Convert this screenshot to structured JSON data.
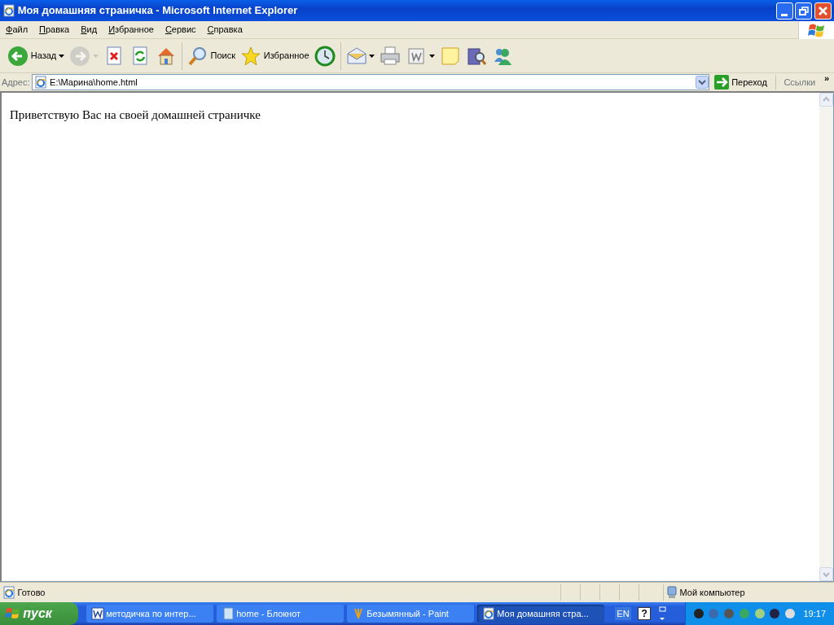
{
  "window": {
    "title": "Моя домашняя страничка - Microsoft Internet Explorer"
  },
  "menu": [
    "Файл",
    "Правка",
    "Вид",
    "Избранное",
    "Сервис",
    "Справка"
  ],
  "toolbar": [
    {
      "label": "Назад",
      "dropdown": true,
      "disabled": false
    },
    {
      "dropdown": true,
      "disabled": true
    },
    {
      "dropdown": false,
      "disabled": false
    },
    {
      "dropdown": false,
      "disabled": false
    },
    {
      "dropdown": false,
      "disabled": false
    },
    {
      "label": "Поиск",
      "dropdown": false,
      "disabled": false
    },
    {
      "label": "Избранное",
      "dropdown": false,
      "disabled": false
    },
    {
      "dropdown": false,
      "disabled": false
    },
    {
      "dropdown": true,
      "disabled": false
    },
    {
      "dropdown": false,
      "disabled": false
    },
    {
      "dropdown": true,
      "disabled": false
    },
    {
      "dropdown": false,
      "disabled": false
    },
    {
      "dropdown": false,
      "disabled": false
    },
    {
      "dropdown": false,
      "disabled": false
    }
  ],
  "address": {
    "label": "Адрес:",
    "value": "E:\\Марина\\home.html",
    "go": "Переход",
    "links": "Ссылки",
    "more": "»"
  },
  "page": {
    "text": "Приветствую Вас на своей домашней страничке"
  },
  "status_bar": {
    "text": "Готово",
    "zone": "Мой компьютер"
  },
  "taskbar": {
    "start": "пуск",
    "tasks": [
      {
        "label": "методичка по интер...",
        "selected": false
      },
      {
        "label": "home - Блокнот",
        "selected": false
      },
      {
        "label": "Безымянный - Paint",
        "selected": false
      },
      {
        "label": "Моя домашняя стра...",
        "selected": true
      }
    ],
    "language": "EN",
    "help": "?",
    "clock": "19:17"
  }
}
